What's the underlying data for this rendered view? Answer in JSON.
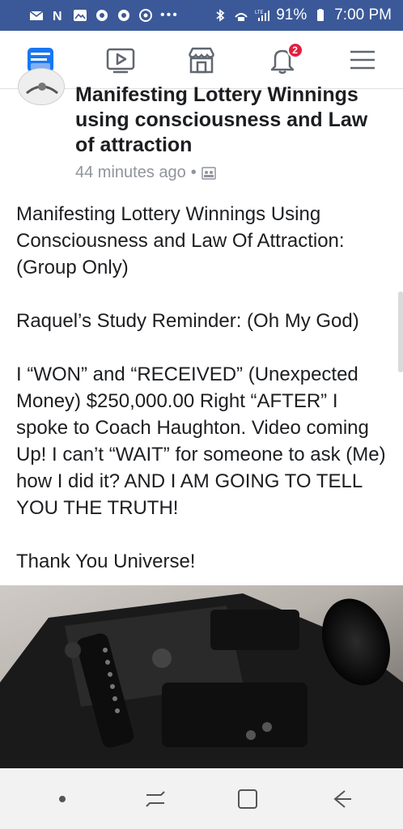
{
  "status_bar": {
    "battery_percent": "91%",
    "time": "7:00 PM",
    "network": "LTE",
    "icons": [
      "mail-icon",
      "n-icon",
      "gallery-icon",
      "chrome-icon",
      "chrome-icon",
      "camera-icon",
      "more-icon",
      "bluetooth-icon",
      "wifi-call-icon",
      "signal-icon",
      "battery-icon"
    ]
  },
  "nav": {
    "items": [
      {
        "name": "news-feed-icon",
        "active": true
      },
      {
        "name": "watch-icon",
        "active": false
      },
      {
        "name": "marketplace-icon",
        "active": false
      },
      {
        "name": "notifications-icon",
        "active": false,
        "badge": "2"
      },
      {
        "name": "menu-icon",
        "active": false
      }
    ],
    "accent": "#1877f2"
  },
  "post": {
    "title": "Manifesting Lottery Winnings using consciousness and Law of attraction",
    "time": "44 minutes ago",
    "separator": "•",
    "privacy_icon": "group-icon",
    "body": [
      "Manifesting Lottery Winnings Using Consciousness and Law Of Attraction: (Group Only)",
      "Raquel’s Study Reminder: (Oh My God)",
      "I “WON” and “RECEIVED” (Unexpected Money) $250,000.00 Right “AFTER” I spoke to Coach Haughton. Video coming Up! I can’t “WAIT” for someone to ask (Me) how I did it? AND I AM GOING TO TELL YOU THE TRUTH!",
      "Thank You Universe!"
    ],
    "image_icon": "video-camera-photo"
  },
  "system_nav": {
    "items": [
      "dot-icon",
      "recents-icon",
      "home-icon",
      "back-icon"
    ]
  }
}
